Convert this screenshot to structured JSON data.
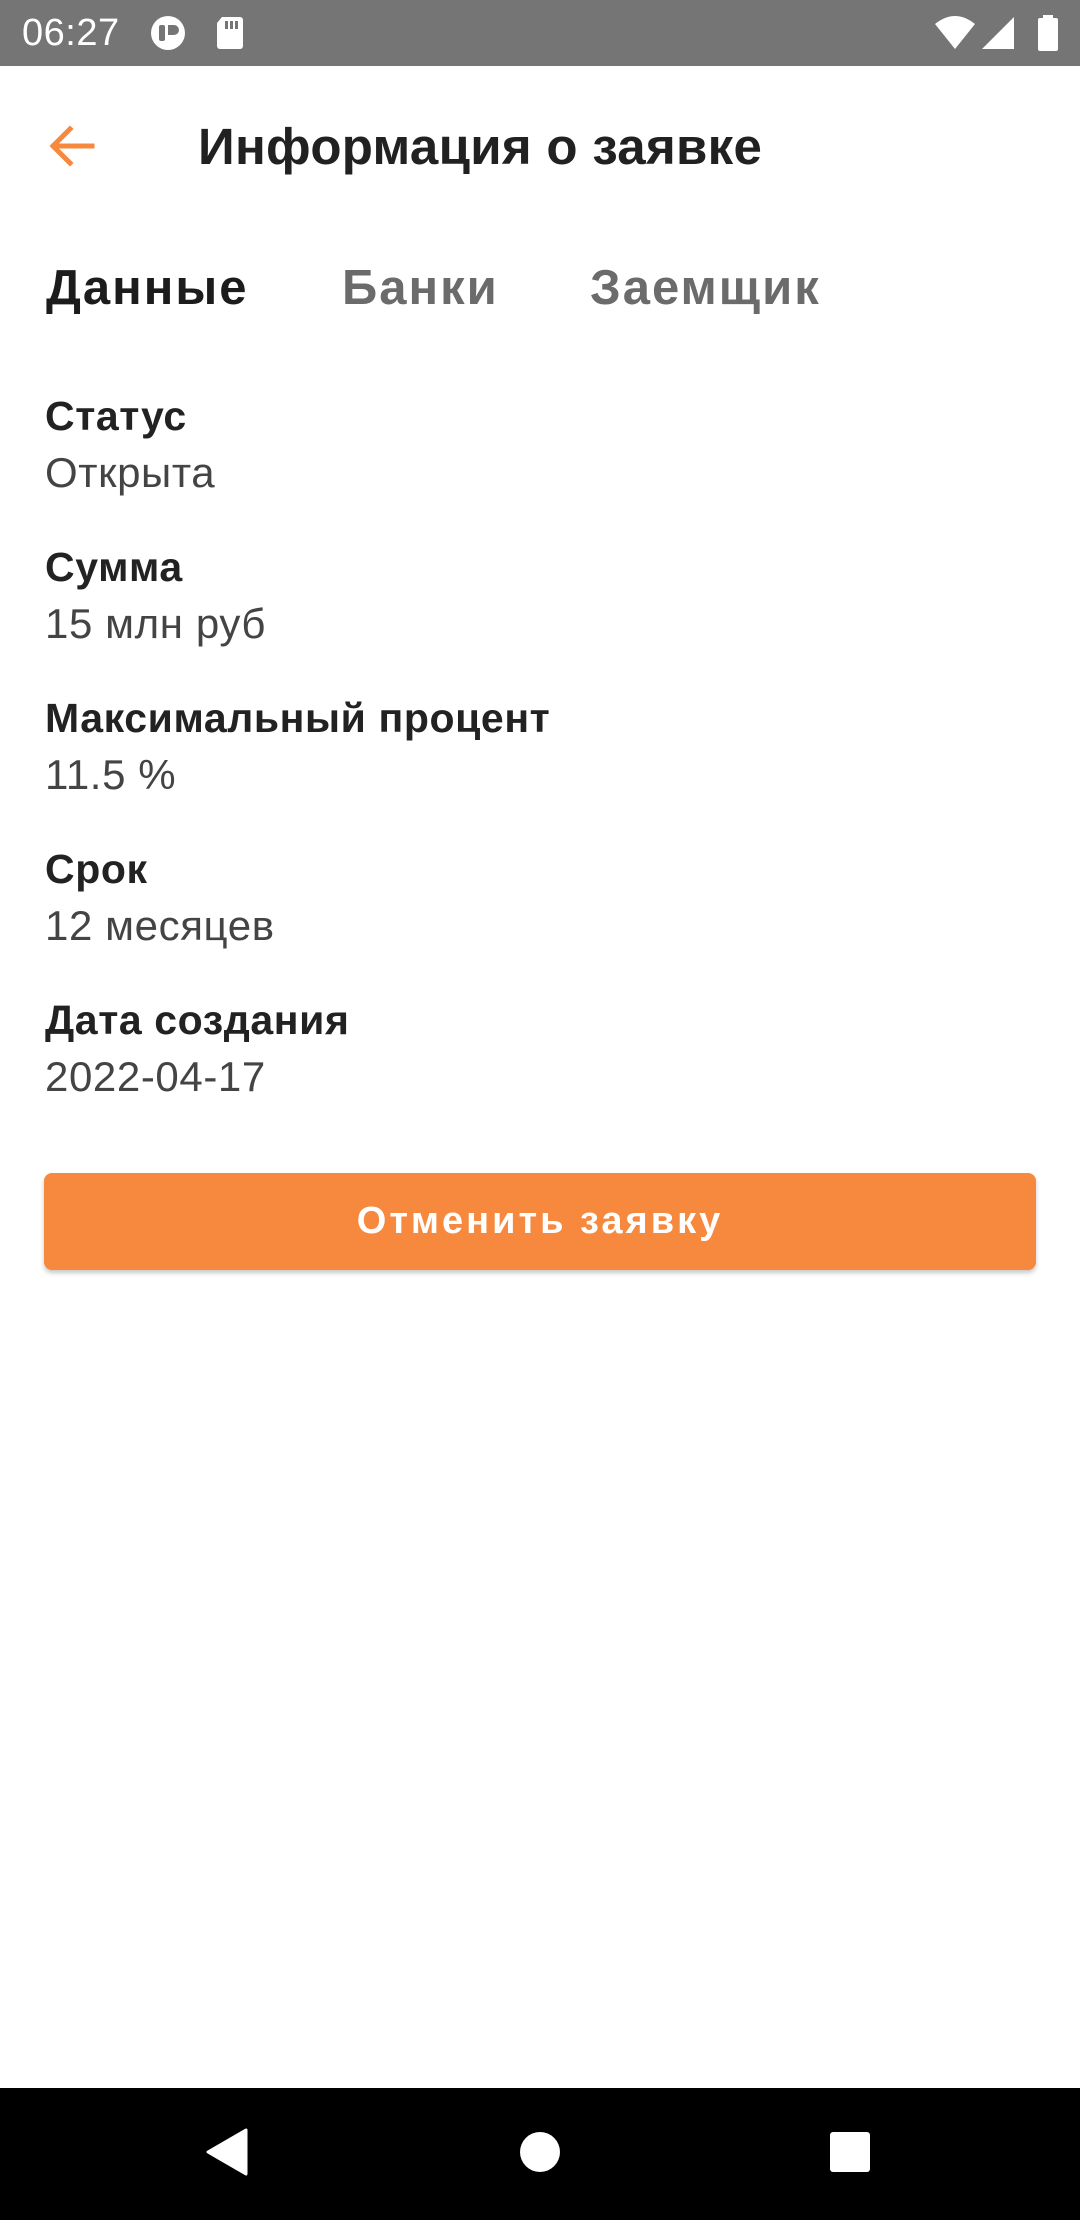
{
  "status_bar": {
    "time": "06:27",
    "icons": [
      "notification-app-icon",
      "sd-card-icon",
      "wifi-icon",
      "signal-icon",
      "battery-icon"
    ]
  },
  "app_bar": {
    "title": "Информация о заявке",
    "back_icon": "arrow-left-icon",
    "accent_color": "#F7893E"
  },
  "tabs": [
    {
      "label": "Данные",
      "active": true
    },
    {
      "label": "Банки",
      "active": false
    },
    {
      "label": "Заемщик",
      "active": false
    }
  ],
  "details": [
    {
      "label": "Статус",
      "value": "Открыта"
    },
    {
      "label": "Сумма",
      "value": "15 млн руб"
    },
    {
      "label": "Максимальный процент",
      "value": "11.5 %"
    },
    {
      "label": "Срок",
      "value": "12 месяцев"
    },
    {
      "label": "Дата создания",
      "value": "2022-04-17"
    }
  ],
  "actions": {
    "cancel_label": "Отменить заявку",
    "cancel_color": "#F7893E"
  },
  "nav_bar": {
    "buttons": [
      "back-triangle-icon",
      "home-circle-icon",
      "recents-square-icon"
    ]
  }
}
